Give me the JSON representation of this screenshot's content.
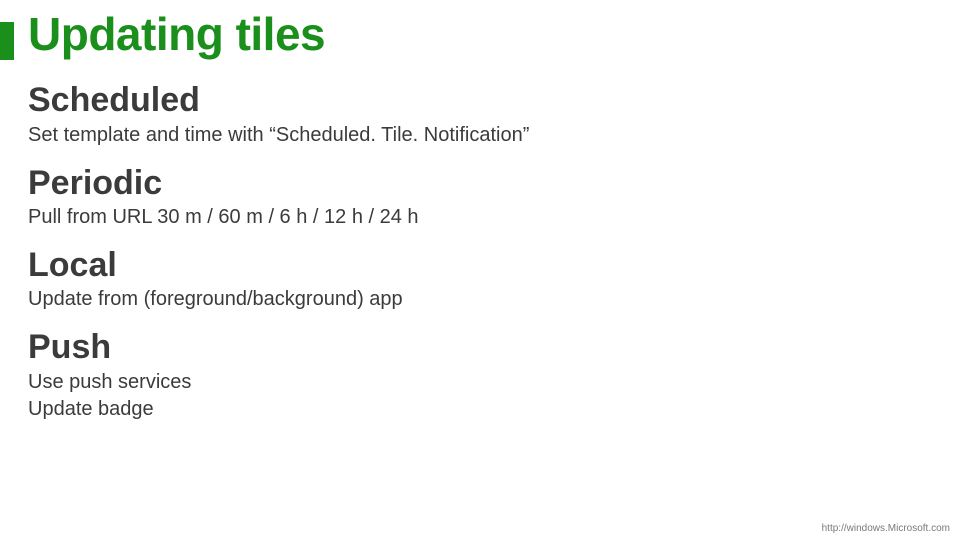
{
  "title": "Updating tiles",
  "sections": [
    {
      "heading": "Scheduled",
      "body": "Set template and time with “Scheduled. Tile. Notification”"
    },
    {
      "heading": "Periodic",
      "body": "Pull from URL 30 m / 60 m / 6 h / 12 h / 24 h"
    },
    {
      "heading": "Local",
      "body": "Update from (foreground/background) app"
    },
    {
      "heading": "Push",
      "body": "Use push services\nUpdate badge"
    }
  ],
  "footer": {
    "url": "http://windows.Microsoft.com"
  },
  "colors": {
    "accent": "#1b8f1b",
    "text": "#3b3b3b",
    "footer": "#7a7a7a"
  }
}
